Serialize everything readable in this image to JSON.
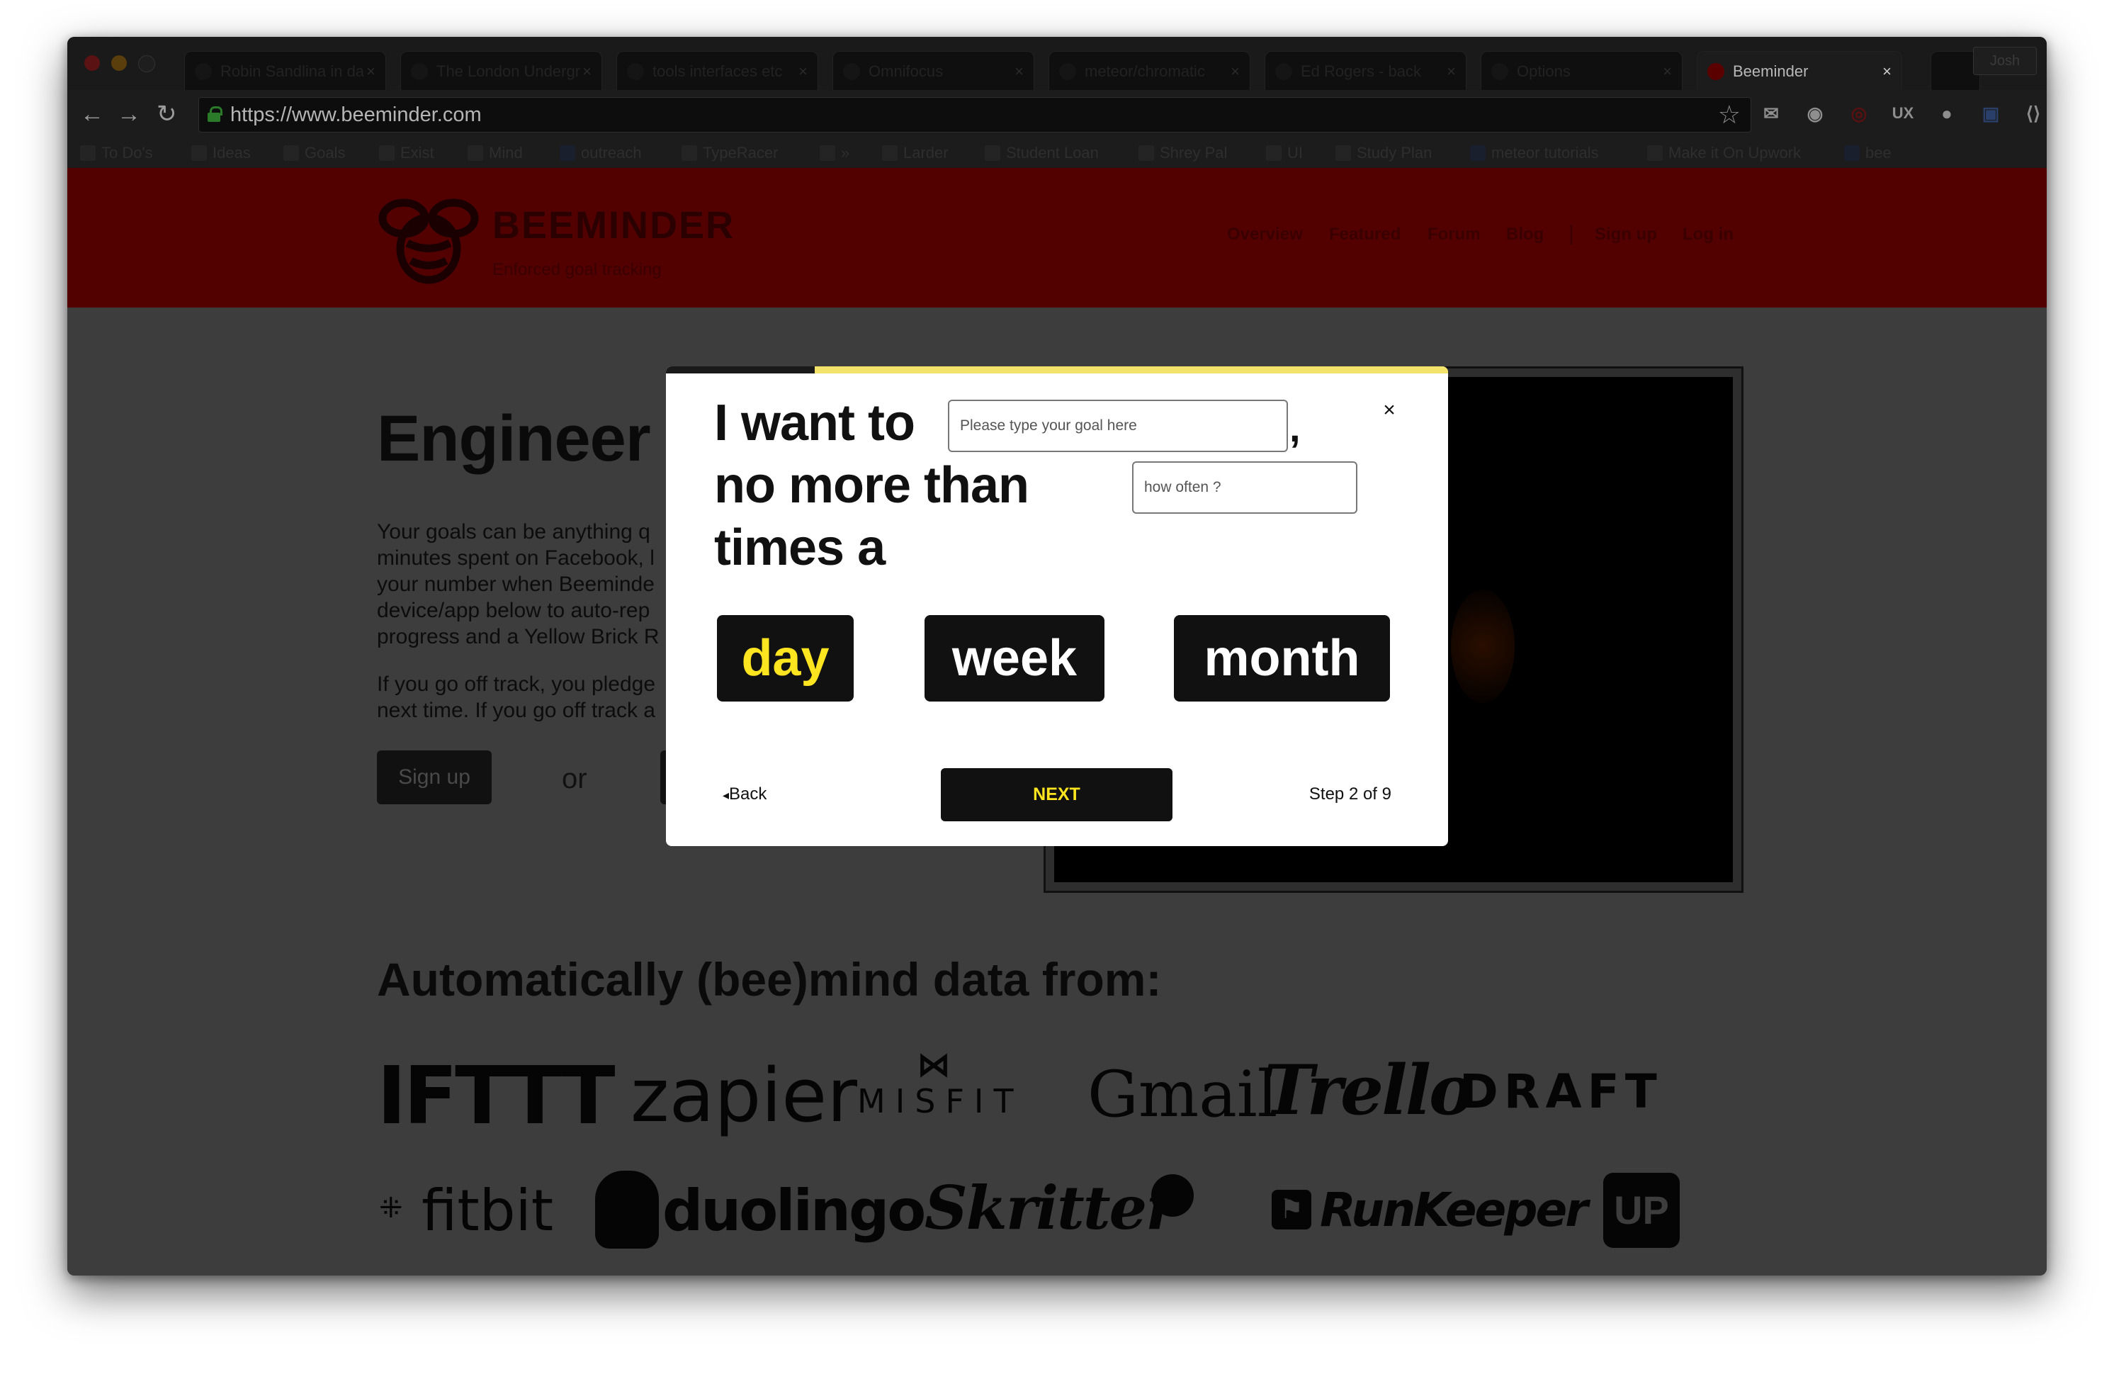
{
  "browser": {
    "tabs": [
      {
        "label": "Robin Sandlina in da"
      },
      {
        "label": "The London Undergr"
      },
      {
        "label": "tools interfaces etc"
      },
      {
        "label": "Omnifocus"
      },
      {
        "label": "meteor/chromatic"
      },
      {
        "label": "Ed Rogers - back"
      },
      {
        "label": "Options"
      },
      {
        "label": "Beeminder"
      }
    ],
    "active_tab": "Beeminder",
    "profile": "Josh",
    "url": "https://www.beeminder.com",
    "bookmarks": [
      {
        "label": "To Do's"
      },
      {
        "label": "Ideas"
      },
      {
        "label": "Goals"
      },
      {
        "label": "Exist"
      },
      {
        "label": "Mind"
      },
      {
        "label": "outreach"
      },
      {
        "label": "TypeRacer"
      },
      {
        "label": "»"
      },
      {
        "label": "Larder"
      },
      {
        "label": "Student Loan"
      },
      {
        "label": "Shrey Pal"
      },
      {
        "label": "UI"
      },
      {
        "label": "Study Plan"
      },
      {
        "label": "meteor tutorials"
      },
      {
        "label": "Make it On Upwork"
      },
      {
        "label": "bee"
      }
    ],
    "extensions": [
      "ux-label",
      "UX"
    ]
  },
  "site": {
    "brand": "BEEMINDER",
    "tagline": "Enforced goal tracking",
    "nav": [
      "Overview",
      "Featured",
      "Forum",
      "Blog",
      "|",
      "Sign up",
      "Log in"
    ],
    "hero_title": "Engineer Yourself",
    "hero_p1": [
      "Your goals can be anything q",
      "minutes spent on Facebook, l",
      "your number when Beeminde",
      "device/app below to auto-rep",
      "progress and a Yellow Brick R"
    ],
    "hero_p2": [
      "If you go off track, you pledge",
      "next time. If you go off track a"
    ],
    "signup": "Sign up",
    "or": "or",
    "section_title": "Automatically (bee)mind data from:",
    "integrations": [
      "IFTTT",
      "zapier",
      "MISFIT",
      "Gmail",
      "Trello",
      "DRAFT",
      "fitbit",
      "duolingo",
      "Skritter",
      "RunKeeper",
      "UP"
    ]
  },
  "modal": {
    "progress_fraction": 0.19,
    "line1": "I want to",
    "line2": "no more than",
    "line3": "times a",
    "comma": ",",
    "goal_placeholder": "Please type your goal here",
    "frequency_placeholder": "how often ?",
    "close": "×",
    "periods": [
      {
        "label": "day",
        "selected": true
      },
      {
        "label": "week",
        "selected": false
      },
      {
        "label": "month",
        "selected": false
      }
    ],
    "back": "🡸 Back",
    "back_label": "Back",
    "next": "NEXT",
    "step": "Step 2 of 9"
  },
  "colors": {
    "header_red": "#520000",
    "accent_yellow": "#ffe51f",
    "button_dark": "#111111"
  }
}
